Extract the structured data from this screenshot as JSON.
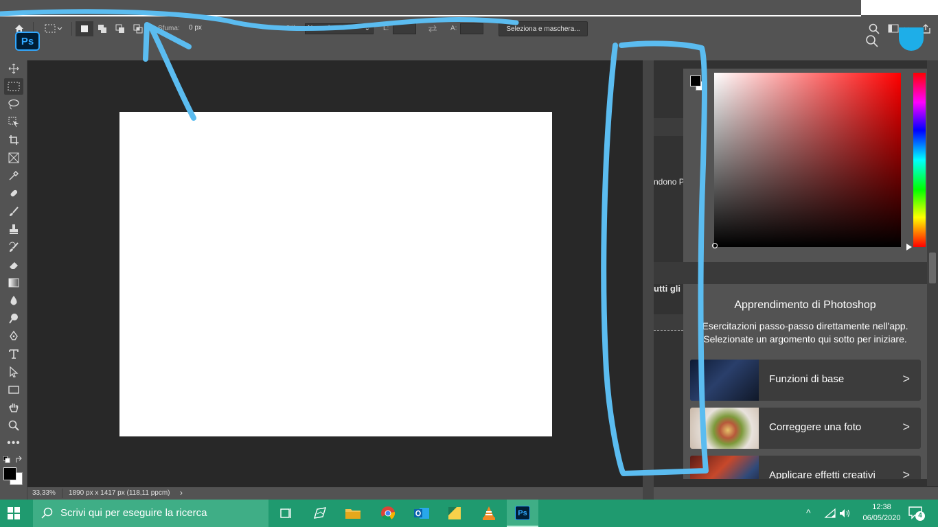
{
  "options_bar": {
    "feather_label": "Sfuma:",
    "feather_value": "0 px",
    "style_label": "Stile:",
    "style_value": "Normale",
    "width_label": "L:",
    "height_label": "A:",
    "select_mask_button": "Seleziona e maschera..."
  },
  "app": {
    "logo": "Ps"
  },
  "side_fragments": {
    "frag1": "ndono P",
    "frag2": "utti gli a"
  },
  "status": {
    "zoom": "33,33%",
    "doc_info": "1890 px x 1417 px (118,11 ppcm)"
  },
  "learn": {
    "title": "Apprendimento di Photoshop",
    "subtitle_line1": "Esercitazioni passo-passo direttamente nell'app.",
    "subtitle_line2": "Selezionate un argomento qui sotto per iniziare.",
    "items": [
      {
        "label": "Funzioni di base"
      },
      {
        "label": "Correggere una foto"
      },
      {
        "label": "Applicare effetti creativi"
      }
    ]
  },
  "taskbar": {
    "search_placeholder": "Scrivi qui per eseguire la ricerca",
    "time": "12:38",
    "date": "06/05/2020",
    "notification_count": "4"
  },
  "colors": {
    "annotation": "#5bbcf0",
    "taskbar": "#1f9a6f",
    "ps_blue": "#31a8ff"
  }
}
